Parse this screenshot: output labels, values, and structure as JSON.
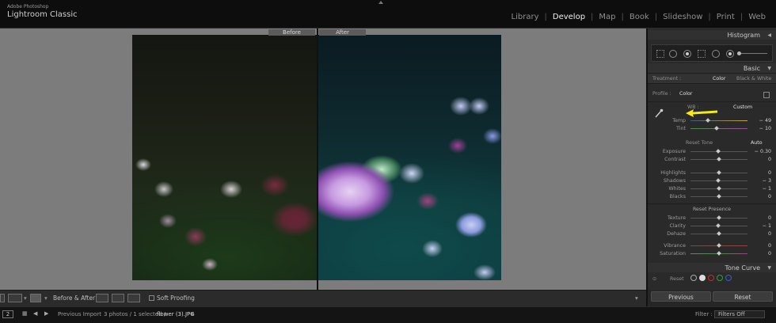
{
  "app": {
    "vendor": "Adobe Photoshop",
    "name": "Lightroom Classic",
    "modules": [
      "Library",
      "Develop",
      "Map",
      "Book",
      "Slideshow",
      "Print",
      "Web"
    ],
    "active_module": "Develop"
  },
  "view": {
    "before_label": "Before",
    "after_label": "After"
  },
  "panel": {
    "histogram_title": "Histogram",
    "basic_title": "Basic",
    "treatment_label": "Treatment :",
    "treatment_color": "Color",
    "treatment_bw": "Black & White",
    "profile_label": "Profile :",
    "profile_value": "Color",
    "wb_label": "WB :",
    "wb_value": "Custom",
    "temp_label": "Temp",
    "temp_value": "− 49",
    "tint_label": "Tint",
    "tint_value": "− 10",
    "reset_tone": "Reset Tone",
    "auto": "Auto",
    "exposure_label": "Exposure",
    "exposure_value": "− 0.30",
    "contrast_label": "Contrast",
    "contrast_value": "0",
    "highlights_label": "Highlights",
    "highlights_value": "0",
    "shadows_label": "Shadows",
    "shadows_value": "− 3",
    "whites_label": "Whites",
    "whites_value": "− 1",
    "blacks_label": "Blacks",
    "blacks_value": "0",
    "reset_presence": "Reset Presence",
    "texture_label": "Texture",
    "texture_value": "0",
    "clarity_label": "Clarity",
    "clarity_value": "− 1",
    "dehaze_label": "Dehaze",
    "dehaze_value": "0",
    "vibrance_label": "Vibrance",
    "vibrance_value": "0",
    "saturation_label": "Saturation",
    "saturation_value": "0",
    "tone_curve_title": "Tone Curve",
    "tone_curve_reset": "Reset",
    "previous_button": "Previous",
    "reset_button": "Reset"
  },
  "toolbar": {
    "before_after_label": "Before & After :",
    "soft_proofing_label": "Soft Proofing"
  },
  "filmstrip": {
    "monitor_number": "2",
    "source": "Previous Import",
    "info_prefix": "3 photos / 1 selected / ",
    "file_name": "flower (3).JPG",
    "filter_label": "Filter :",
    "filter_value": "Filters Off"
  },
  "colors": {
    "accent_arrow": "#f5ea14",
    "canvas_bg": "#7c7c7c"
  }
}
